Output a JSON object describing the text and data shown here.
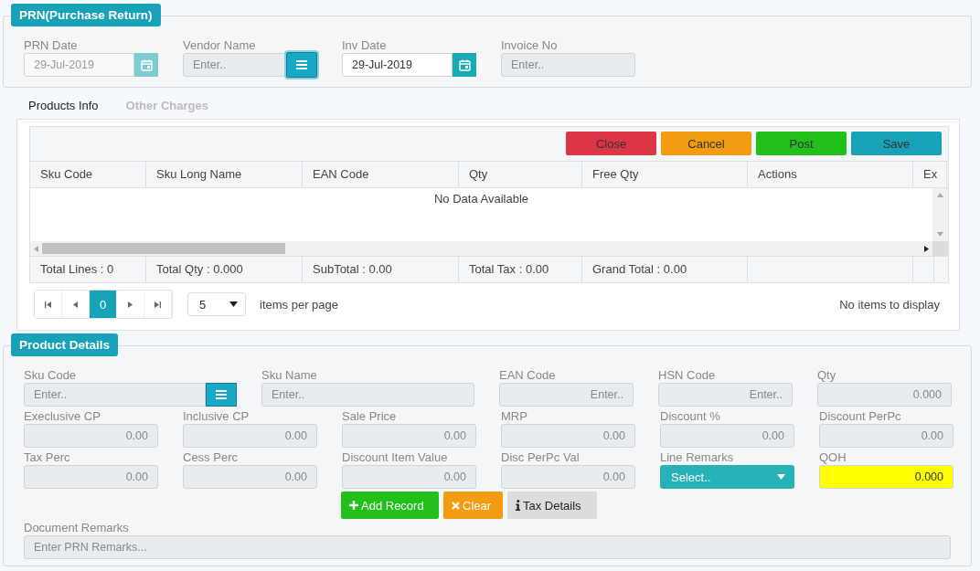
{
  "header": {
    "title": "PRN(Purchase Return)",
    "fields": [
      {
        "label": "PRN Date",
        "kind": "date",
        "value": "29-Jul-2019",
        "disabled": true
      },
      {
        "label": "Vendor Name",
        "kind": "lookup",
        "placeholder": "Enter..",
        "disabled": true
      },
      {
        "label": "Inv Date",
        "kind": "date",
        "value": "29-Jul-2019",
        "disabled": false
      },
      {
        "label": "Invoice No",
        "kind": "text",
        "placeholder": "Enter..",
        "disabled": true
      }
    ]
  },
  "tabs": [
    {
      "label": "Products Info",
      "selected": true
    },
    {
      "label": "Other Charges",
      "selected": false
    }
  ],
  "actions": [
    {
      "label": "Close",
      "color": "#dc3545"
    },
    {
      "label": "Cancel",
      "color": "#f39c12"
    },
    {
      "label": "Post",
      "color": "#22c01a"
    },
    {
      "label": "Save",
      "color": "#17a2b8"
    }
  ],
  "table": {
    "columns": [
      "Sku Code",
      "Sku Long Name",
      "EAN Code",
      "Qty",
      "Free Qty",
      "Actions",
      "Ex"
    ],
    "empty_message": "No Data Available",
    "footer": [
      "Total Lines : 0",
      "Total Qty : 0.000",
      "SubTotal : 0.00",
      "Total Tax : 0.00",
      "Grand Total : 0.00"
    ]
  },
  "pager": {
    "pages": [
      {
        "label": "0",
        "selected": true
      }
    ],
    "page_size": "5",
    "page_size_label": "items per page",
    "status": "No items to display"
  },
  "product_details": {
    "title": "Product Details",
    "rows": [
      {
        "fields": [
          {
            "label": "Sku Code",
            "kind": "lookup",
            "placeholder": "Enter.."
          },
          {
            "label": "Sku Name",
            "kind": "text",
            "placeholder": "Enter.."
          },
          {
            "label": "EAN Code",
            "kind": "number",
            "placeholder": "Enter.."
          },
          {
            "label": "HSN Code",
            "kind": "number",
            "placeholder": "Enter.."
          },
          {
            "label": "Qty",
            "kind": "number",
            "value": "0.000"
          }
        ]
      },
      {
        "fields": [
          {
            "label": "Execlusive CP",
            "kind": "number",
            "value": "0.00"
          },
          {
            "label": "Inclusive CP",
            "kind": "number",
            "value": "0.00"
          },
          {
            "label": "Sale Price",
            "kind": "number",
            "value": "0.00"
          },
          {
            "label": "MRP",
            "kind": "number",
            "value": "0.00"
          },
          {
            "label": "Discount %",
            "kind": "number",
            "value": "0.00"
          },
          {
            "label": "Discount PerPc",
            "kind": "number",
            "value": "0.00"
          }
        ]
      },
      {
        "fields": [
          {
            "label": "Tax Perc",
            "kind": "number",
            "value": "0.00"
          },
          {
            "label": "Cess Perc",
            "kind": "number",
            "value": "0.00"
          },
          {
            "label": "Discount Item Value",
            "kind": "number",
            "value": "0.00"
          },
          {
            "label": "Disc PerPc Val",
            "kind": "number",
            "value": "0.00"
          },
          {
            "label": "Line Remarks",
            "kind": "select",
            "value": "Select.."
          },
          {
            "label": "QOH",
            "kind": "highlight",
            "value": "0.000"
          }
        ]
      }
    ],
    "buttons": [
      {
        "label": "Add Record",
        "kind": "add"
      },
      {
        "label": "Clear",
        "kind": "clear"
      },
      {
        "label": "Tax Details",
        "kind": "info"
      }
    ],
    "remarks": {
      "label": "Document Remarks",
      "placeholder": "Enter PRN Remarks..."
    }
  }
}
